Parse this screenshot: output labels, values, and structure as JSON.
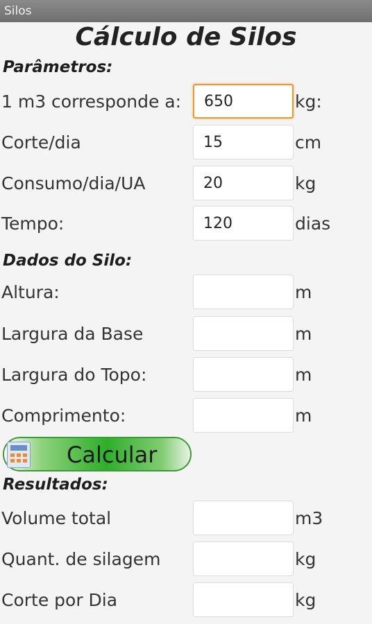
{
  "window": {
    "title": "Silos"
  },
  "app": {
    "title": "Cálculo de Silos"
  },
  "parametros": {
    "header": "Parâmetros:",
    "rows": [
      {
        "label": "1 m3 corresponde a:",
        "value": "650",
        "unit": "kg:"
      },
      {
        "label": "Corte/dia",
        "value": "15",
        "unit": "cm"
      },
      {
        "label": "Consumo/dia/UA",
        "value": "20",
        "unit": "kg"
      },
      {
        "label": "Tempo:",
        "value": "120",
        "unit": "dias"
      }
    ]
  },
  "silo": {
    "header": "Dados do Silo:",
    "rows": [
      {
        "label": "Altura:",
        "value": "",
        "unit": "m"
      },
      {
        "label": "Largura da Base",
        "value": "",
        "unit": "m"
      },
      {
        "label": "Largura do Topo:",
        "value": "",
        "unit": "m"
      },
      {
        "label": "Comprimento:",
        "value": "",
        "unit": "m"
      }
    ]
  },
  "calcular": {
    "label": "Calcular",
    "icon": "calculator-icon"
  },
  "resultados": {
    "header": "Resultados:",
    "rows": [
      {
        "label": "Volume total",
        "value": "",
        "unit": "m3"
      },
      {
        "label": "Quant. de silagem",
        "value": "",
        "unit": "kg"
      },
      {
        "label": "Corte por Dia",
        "value": "",
        "unit": "kg"
      }
    ]
  },
  "colors": {
    "focus": "#f0962b",
    "button_green": "#2fae2a",
    "titlebar": "#7a7a7a"
  }
}
